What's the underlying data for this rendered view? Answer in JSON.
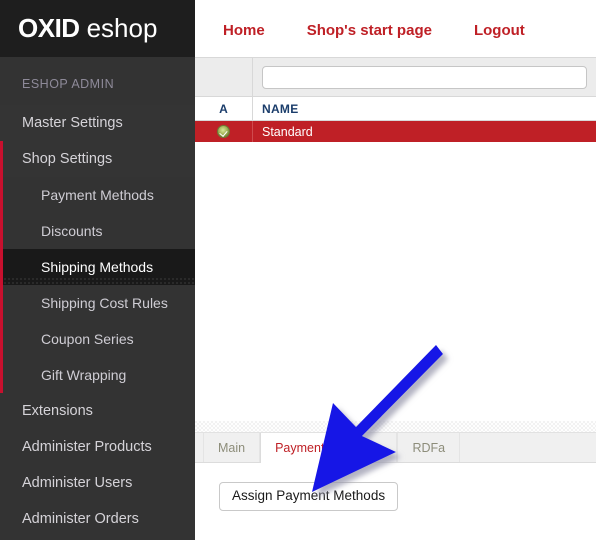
{
  "app": {
    "logo_primary": "OXID",
    "logo_secondary": "eshop"
  },
  "sidebar": {
    "section_label": "ESHOP ADMIN",
    "items": [
      {
        "label": "Master Settings",
        "level": 1,
        "state": "top"
      },
      {
        "label": "Shop Settings",
        "level": 1,
        "state": "open"
      },
      {
        "label": "Payment Methods",
        "level": 2,
        "state": "normal"
      },
      {
        "label": "Discounts",
        "level": 2,
        "state": "normal"
      },
      {
        "label": "Shipping Methods",
        "level": 2,
        "state": "active"
      },
      {
        "label": "Shipping Cost Rules",
        "level": 2,
        "state": "normal"
      },
      {
        "label": "Coupon Series",
        "level": 2,
        "state": "normal"
      },
      {
        "label": "Gift Wrapping",
        "level": 2,
        "state": "normal"
      },
      {
        "label": "Extensions",
        "level": 1,
        "state": "normal"
      },
      {
        "label": "Administer Products",
        "level": 1,
        "state": "normal"
      },
      {
        "label": "Administer Users",
        "level": 1,
        "state": "normal"
      },
      {
        "label": "Administer Orders",
        "level": 1,
        "state": "normal"
      }
    ]
  },
  "topnav": {
    "links": [
      "Home",
      "Shop's start page",
      "Logout"
    ]
  },
  "list": {
    "search_value": "",
    "search_placeholder": "",
    "columns": [
      "A",
      "NAME"
    ],
    "rows": [
      {
        "status_icon": "active-check-icon",
        "name": "Standard",
        "selected": true
      }
    ]
  },
  "tabs": {
    "items": [
      {
        "label": "Main",
        "active": false
      },
      {
        "label": "Payment",
        "active": true
      },
      {
        "label": "",
        "active": false
      },
      {
        "label": "RDFa",
        "active": false
      }
    ]
  },
  "tab_panel": {
    "assign_button": "Assign Payment Methods"
  },
  "annotation": {
    "arrow_color": "#1414e6",
    "arrow_shadow": "#b8b8c8"
  },
  "colors": {
    "brand_red": "#bf2026",
    "sidebar_bg": "#333333",
    "sidebar_logo_bg": "#1e1e1e",
    "accent_rail": "#c8102e",
    "row_selected": "#bf2026",
    "header_text": "#1b3d6b"
  }
}
